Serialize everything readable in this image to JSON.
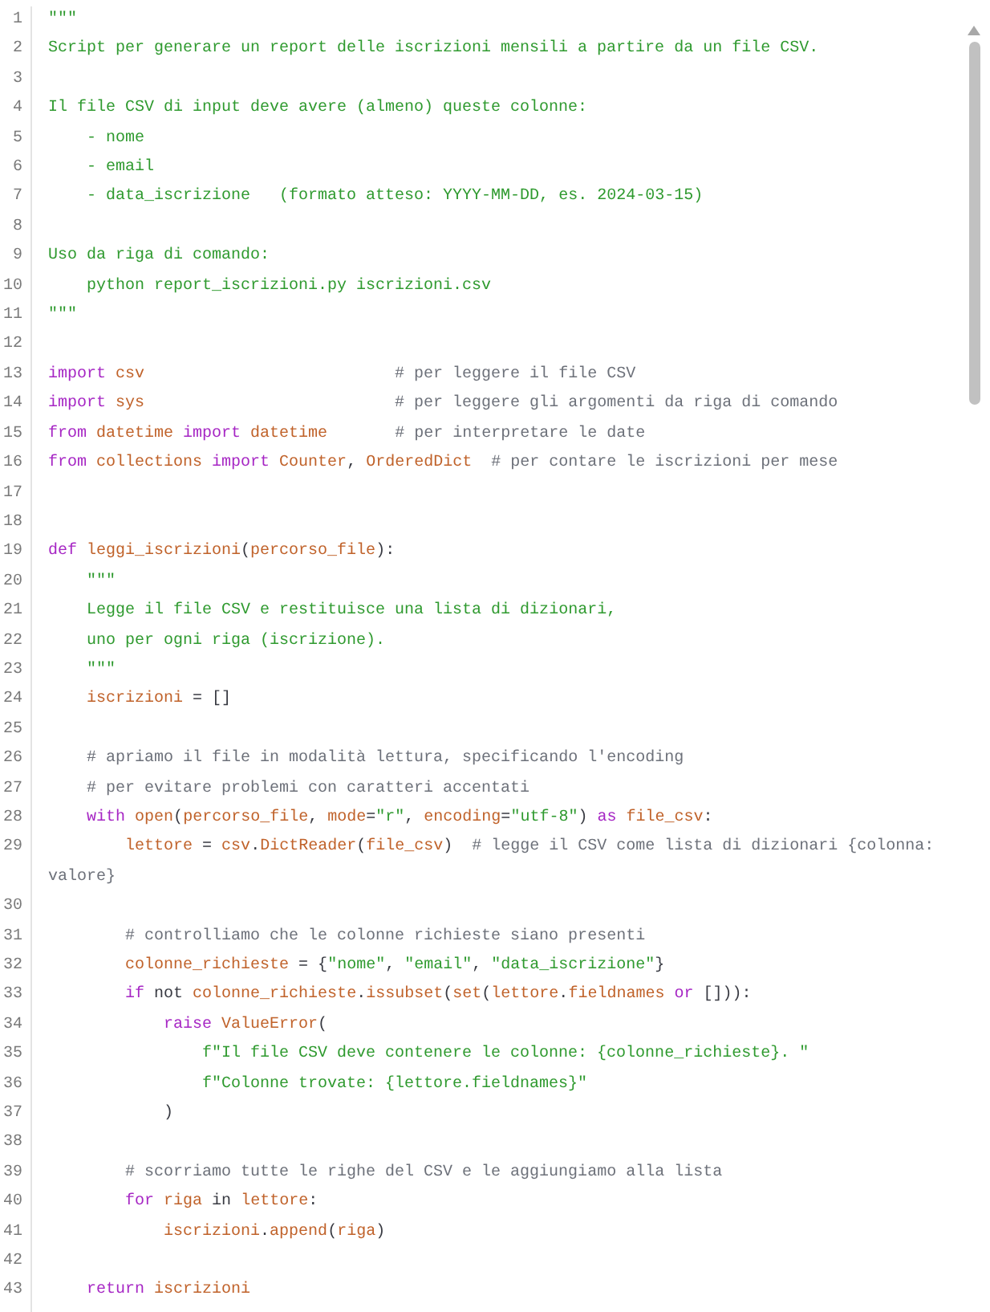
{
  "editor": {
    "lines": [
      {
        "number": "1",
        "tokens": [
          {
            "kind": "str",
            "text": "\"\"\""
          }
        ]
      },
      {
        "number": "2",
        "tokens": [
          {
            "kind": "str",
            "text": "Script per generare un report delle iscrizioni mensili a partire da un file CSV."
          }
        ]
      },
      {
        "number": "3"
      },
      {
        "number": "4",
        "tokens": [
          {
            "kind": "str",
            "text": "Il file CSV di input deve avere (almeno) queste colonne:"
          }
        ]
      },
      {
        "number": "5",
        "tokens": [
          {
            "kind": "str",
            "text": "    - nome"
          }
        ]
      },
      {
        "number": "6",
        "tokens": [
          {
            "kind": "str",
            "text": "    - email"
          }
        ]
      },
      {
        "number": "7",
        "tokens": [
          {
            "kind": "str",
            "text": "    - data_iscrizione   (formato atteso: YYYY-MM-DD, es. 2024-03-15)"
          }
        ]
      },
      {
        "number": "8"
      },
      {
        "number": "9",
        "tokens": [
          {
            "kind": "str",
            "text": "Uso da riga di comando:"
          }
        ]
      },
      {
        "number": "10",
        "tokens": [
          {
            "kind": "str",
            "text": "    python report_iscrizioni.py iscrizioni.csv"
          }
        ]
      },
      {
        "number": "11",
        "tokens": [
          {
            "kind": "str",
            "text": "\"\"\""
          }
        ]
      },
      {
        "number": "12"
      },
      {
        "number": "13",
        "tokens": [
          {
            "kind": "kw",
            "text": "import "
          },
          {
            "kind": "name",
            "text": "csv                          "
          },
          {
            "kind": "com",
            "text": "# per leggere il file CSV"
          }
        ]
      },
      {
        "number": "14",
        "tokens": [
          {
            "kind": "kw",
            "text": "import "
          },
          {
            "kind": "name",
            "text": "sys                          "
          },
          {
            "kind": "com",
            "text": "# per leggere gli argomenti da riga di comando"
          }
        ]
      },
      {
        "number": "15",
        "tokens": [
          {
            "kind": "kw",
            "text": "from "
          },
          {
            "kind": "name",
            "text": "datetime "
          },
          {
            "kind": "kw",
            "text": "import "
          },
          {
            "kind": "name",
            "text": "datetime       "
          },
          {
            "kind": "com",
            "text": "# per interpretare le date"
          }
        ]
      },
      {
        "number": "16",
        "tokens": [
          {
            "kind": "kw",
            "text": "from "
          },
          {
            "kind": "name",
            "text": "collections "
          },
          {
            "kind": "kw",
            "text": "import "
          },
          {
            "kind": "name",
            "text": "Counter"
          },
          {
            "kind": "plain",
            "text": ", "
          },
          {
            "kind": "name",
            "text": "OrderedDict  "
          },
          {
            "kind": "com",
            "text": "# per contare le iscrizioni per mese"
          }
        ]
      },
      {
        "number": "17"
      },
      {
        "number": "18"
      },
      {
        "number": "19",
        "tokens": [
          {
            "kind": "kw",
            "text": "def "
          },
          {
            "kind": "name",
            "text": "leggi_iscrizioni"
          },
          {
            "kind": "plain",
            "text": "("
          },
          {
            "kind": "name",
            "text": "percorso_file"
          },
          {
            "kind": "plain",
            "text": "):"
          }
        ]
      },
      {
        "number": "20",
        "tokens": [
          {
            "kind": "str",
            "text": "    \"\"\""
          }
        ]
      },
      {
        "number": "21",
        "tokens": [
          {
            "kind": "str",
            "text": "    Legge il file CSV e restituisce una lista di dizionari,"
          }
        ]
      },
      {
        "number": "22",
        "tokens": [
          {
            "kind": "str",
            "text": "    uno per ogni riga (iscrizione)."
          }
        ]
      },
      {
        "number": "23",
        "tokens": [
          {
            "kind": "str",
            "text": "    \"\"\""
          }
        ]
      },
      {
        "number": "24",
        "tokens": [
          {
            "kind": "name",
            "text": "    iscrizioni"
          },
          {
            "kind": "plain",
            "text": " = []"
          }
        ]
      },
      {
        "number": "25"
      },
      {
        "number": "26",
        "tokens": [
          {
            "kind": "com",
            "text": "    # apriamo il file in modalità lettura, specificando l'encoding"
          }
        ]
      },
      {
        "number": "27",
        "tokens": [
          {
            "kind": "com",
            "text": "    # per evitare problemi con caratteri accentati"
          }
        ]
      },
      {
        "number": "28",
        "tokens": [
          {
            "kind": "kw",
            "text": "    with "
          },
          {
            "kind": "name",
            "text": "open"
          },
          {
            "kind": "plain",
            "text": "("
          },
          {
            "kind": "name",
            "text": "percorso_file"
          },
          {
            "kind": "plain",
            "text": ", "
          },
          {
            "kind": "name",
            "text": "mode"
          },
          {
            "kind": "plain",
            "text": "="
          },
          {
            "kind": "str",
            "text": "\"r\""
          },
          {
            "kind": "plain",
            "text": ", "
          },
          {
            "kind": "name",
            "text": "encoding"
          },
          {
            "kind": "plain",
            "text": "="
          },
          {
            "kind": "str",
            "text": "\"utf-8\""
          },
          {
            "kind": "plain",
            "text": ") "
          },
          {
            "kind": "kw",
            "text": "as "
          },
          {
            "kind": "name",
            "text": "file_csv"
          },
          {
            "kind": "plain",
            "text": ":"
          }
        ]
      },
      {
        "number": "29",
        "tokens": [
          {
            "kind": "name",
            "text": "        lettore"
          },
          {
            "kind": "plain",
            "text": " = "
          },
          {
            "kind": "name",
            "text": "csv"
          },
          {
            "kind": "plain",
            "text": "."
          },
          {
            "kind": "name",
            "text": "DictReader"
          },
          {
            "kind": "plain",
            "text": "("
          },
          {
            "kind": "name",
            "text": "file_csv"
          },
          {
            "kind": "plain",
            "text": ")  "
          },
          {
            "kind": "com",
            "text": "# legge il CSV come lista di dizionari {colonna: valore}"
          }
        ]
      },
      {
        "number": "30"
      },
      {
        "number": "31",
        "tokens": [
          {
            "kind": "com",
            "text": "        # controlliamo che le colonne richieste siano presenti"
          }
        ]
      },
      {
        "number": "32",
        "tokens": [
          {
            "kind": "name",
            "text": "        colonne_richieste"
          },
          {
            "kind": "plain",
            "text": " = {"
          },
          {
            "kind": "str",
            "text": "\"nome\""
          },
          {
            "kind": "plain",
            "text": ", "
          },
          {
            "kind": "str",
            "text": "\"email\""
          },
          {
            "kind": "plain",
            "text": ", "
          },
          {
            "kind": "str",
            "text": "\"data_iscrizione\""
          },
          {
            "kind": "plain",
            "text": "}"
          }
        ]
      },
      {
        "number": "33",
        "tokens": [
          {
            "kind": "kw",
            "text": "        if"
          },
          {
            "kind": "plain",
            "text": " not "
          },
          {
            "kind": "name",
            "text": "colonne_richieste"
          },
          {
            "kind": "plain",
            "text": "."
          },
          {
            "kind": "name",
            "text": "issubset"
          },
          {
            "kind": "plain",
            "text": "("
          },
          {
            "kind": "name",
            "text": "set"
          },
          {
            "kind": "plain",
            "text": "("
          },
          {
            "kind": "name",
            "text": "lettore"
          },
          {
            "kind": "plain",
            "text": "."
          },
          {
            "kind": "name",
            "text": "fieldnames "
          },
          {
            "kind": "kw",
            "text": "or"
          },
          {
            "kind": "plain",
            "text": " [])):"
          }
        ]
      },
      {
        "number": "34",
        "tokens": [
          {
            "kind": "kw",
            "text": "            raise "
          },
          {
            "kind": "name",
            "text": "ValueError"
          },
          {
            "kind": "plain",
            "text": "("
          }
        ]
      },
      {
        "number": "35",
        "tokens": [
          {
            "kind": "str",
            "text": "                f\"Il file CSV deve contenere le colonne: {colonne_richieste}. \""
          }
        ]
      },
      {
        "number": "36",
        "tokens": [
          {
            "kind": "str",
            "text": "                f\"Colonne trovate: {lettore.fieldnames}\""
          }
        ]
      },
      {
        "number": "37",
        "tokens": [
          {
            "kind": "plain",
            "text": "            )"
          }
        ]
      },
      {
        "number": "38"
      },
      {
        "number": "39",
        "tokens": [
          {
            "kind": "com",
            "text": "        # scorriamo tutte le righe del CSV e le aggiungiamo alla lista"
          }
        ]
      },
      {
        "number": "40",
        "tokens": [
          {
            "kind": "kw",
            "text": "        for "
          },
          {
            "kind": "name",
            "text": "riga"
          },
          {
            "kind": "plain",
            "text": " in "
          },
          {
            "kind": "name",
            "text": "lettore"
          },
          {
            "kind": "plain",
            "text": ":"
          }
        ]
      },
      {
        "number": "41",
        "tokens": [
          {
            "kind": "name",
            "text": "            iscrizioni"
          },
          {
            "kind": "plain",
            "text": "."
          },
          {
            "kind": "name",
            "text": "append"
          },
          {
            "kind": "plain",
            "text": "("
          },
          {
            "kind": "name",
            "text": "riga"
          },
          {
            "kind": "plain",
            "text": ")"
          }
        ]
      },
      {
        "number": "42"
      },
      {
        "number": "43",
        "tokens": [
          {
            "kind": "kw",
            "text": "    return "
          },
          {
            "kind": "name",
            "text": "iscrizioni"
          }
        ]
      }
    ]
  }
}
